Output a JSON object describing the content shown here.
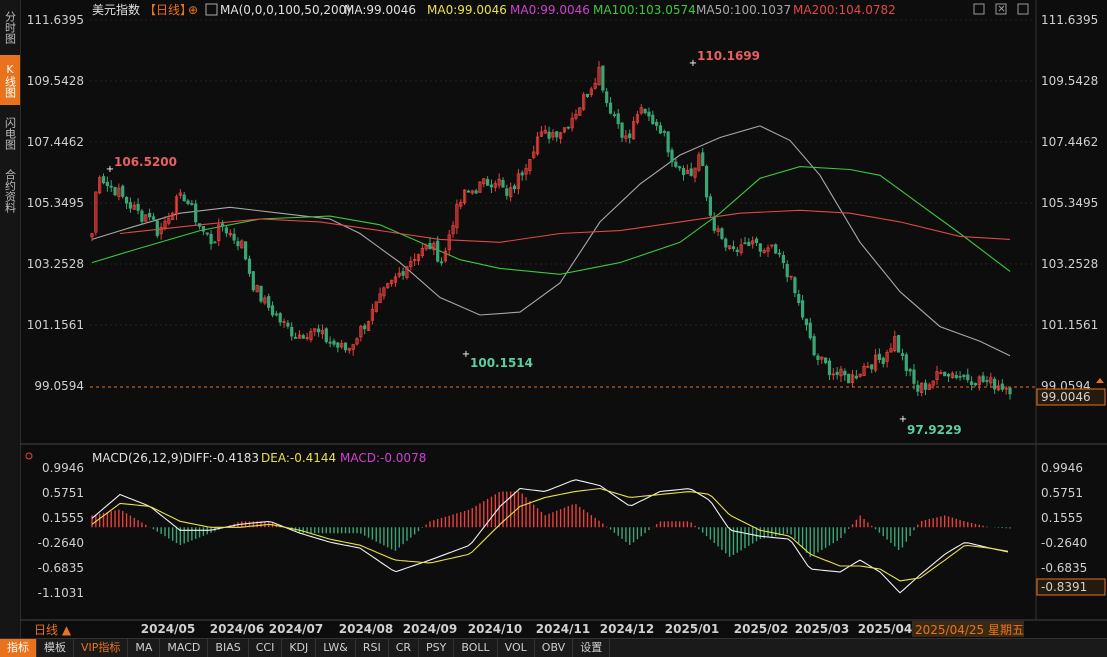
{
  "sidebar": {
    "tabs": [
      {
        "label": "分时图",
        "active": false
      },
      {
        "label": "K线图",
        "active": true
      },
      {
        "label": "闪电图",
        "active": false
      },
      {
        "label": "合约资料",
        "active": false
      }
    ]
  },
  "main_panel": {
    "instrument": "美元指数",
    "period_tag": "【日线】",
    "ma_params": "MA(0,0,0,100,50,200)",
    "ma_values": [
      {
        "text": "MA:99.0046",
        "color": "#e0e0e0"
      },
      {
        "text": "MA0:99.0046",
        "color": "#e8e04a"
      },
      {
        "text": "MA0:99.0046",
        "color": "#d040d0"
      },
      {
        "text": "MA100:103.0574",
        "color": "#3cc83c"
      },
      {
        "text": "MA50:100.1037",
        "color": "#a8a8a8"
      },
      {
        "text": "MA200:104.0782",
        "color": "#e04848"
      }
    ],
    "y_ticks": [
      "111.6395",
      "109.5428",
      "107.4462",
      "105.3495",
      "103.2528",
      "101.1561",
      "99.0594"
    ],
    "current_price": "99.0046",
    "annotations": {
      "high1": "106.5200",
      "low1": "100.1514",
      "high2": "110.1699",
      "low2": "97.9229"
    }
  },
  "macd_panel": {
    "title": "MACD(26,12,9)",
    "diff": "DIFF:-0.4183",
    "dea": "DEA:-0.4144",
    "macd": "MACD:-0.0078",
    "y_ticks": [
      "0.9946",
      "0.5751",
      "0.1555",
      "-0.2640",
      "-0.6835",
      "-1.1031"
    ],
    "current_value": "-0.8391"
  },
  "x_axis": {
    "labels": [
      "2024/05",
      "2024/06",
      "2024/07",
      "2024/08",
      "2024/09",
      "2024/10",
      "2024/11",
      "2024/12",
      "2025/01",
      "2025/02",
      "2025/03",
      "2025/04"
    ],
    "cursor_date": "2025/04/25 星期五"
  },
  "bottom": {
    "period_label": "日线 ▲",
    "toolbar": [
      {
        "label": "指标",
        "active": true,
        "vip": false
      },
      {
        "label": "模板",
        "active": false,
        "vip": false
      },
      {
        "label": "VIP指标",
        "active": false,
        "vip": true
      },
      {
        "label": "MA",
        "active": false,
        "vip": false
      },
      {
        "label": "MACD",
        "active": false,
        "vip": false
      },
      {
        "label": "BIAS",
        "active": false,
        "vip": false
      },
      {
        "label": "CCI",
        "active": false,
        "vip": false
      },
      {
        "label": "KDJ",
        "active": false,
        "vip": false
      },
      {
        "label": "LW&",
        "active": false,
        "vip": false
      },
      {
        "label": "RSI",
        "active": false,
        "vip": false
      },
      {
        "label": "CR",
        "active": false,
        "vip": false
      },
      {
        "label": "PSY",
        "active": false,
        "vip": false
      },
      {
        "label": "BOLL",
        "active": false,
        "vip": false
      },
      {
        "label": "VOL",
        "active": false,
        "vip": false
      },
      {
        "label": "OBV",
        "active": false,
        "vip": false
      },
      {
        "label": "设置",
        "active": false,
        "vip": false
      }
    ]
  },
  "colors": {
    "up": "#e8403c",
    "down": "#3aa676",
    "accent": "#e8731c"
  }
}
